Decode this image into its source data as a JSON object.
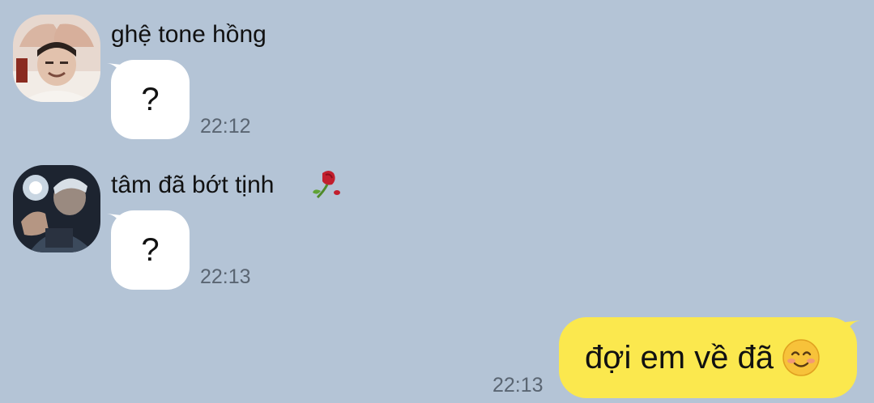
{
  "messages": [
    {
      "sender": "ghệ tone hồng",
      "avatar_icon": "person-avatar-icon",
      "text": "?",
      "time": "22:12"
    },
    {
      "sender": "tâm đã bớt tịnh",
      "sender_emoji_icon": "wilted-rose-icon",
      "avatar_icon": "person-avatar-icon",
      "text": "?",
      "time": "22:13"
    },
    {
      "outgoing": true,
      "text": "đợi em về đã",
      "emoji_icon": "smiling-face-icon",
      "time": "22:13"
    }
  ],
  "colors": {
    "background": "#b4c4d6",
    "incoming_bubble": "#ffffff",
    "outgoing_bubble": "#fbe84e"
  }
}
